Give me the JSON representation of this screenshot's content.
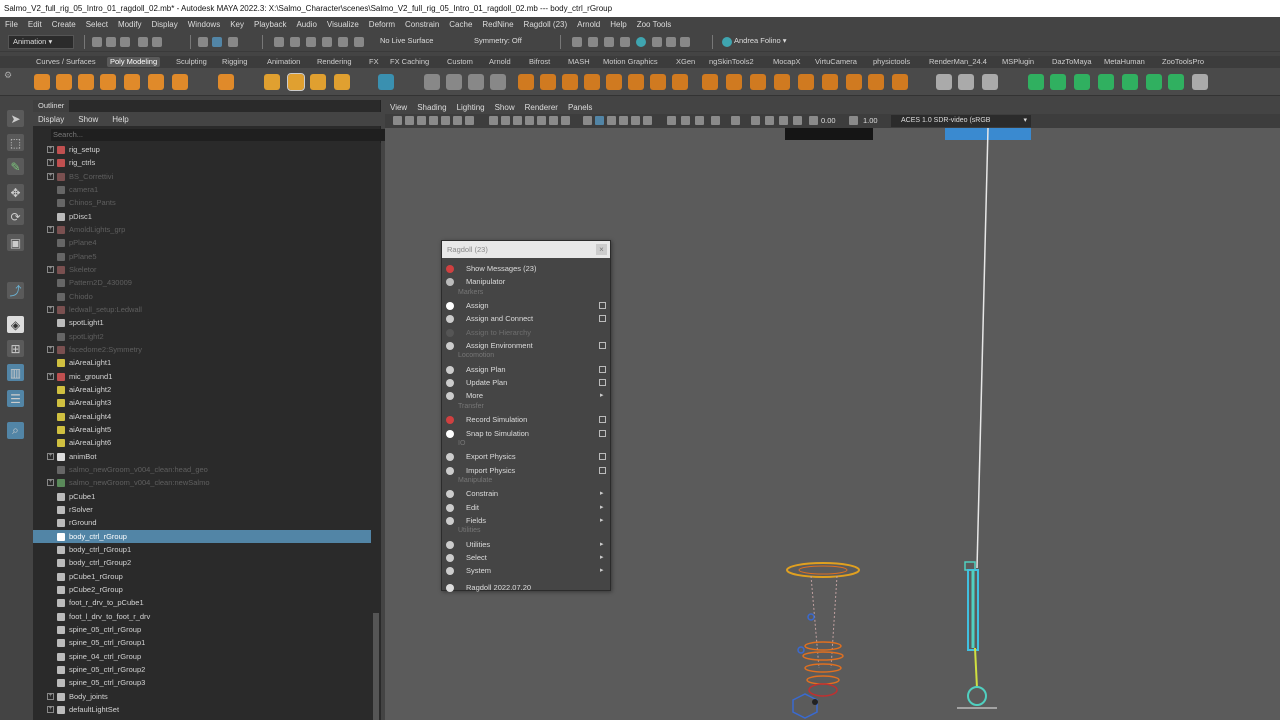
{
  "window": {
    "title": "Salmo_V2_full_rig_05_Intro_01_ragdoll_02.mb* - Autodesk MAYA 2022.3: X:\\Salmo_Character\\scenes\\Salmo_V2_full_rig_05_Intro_01_ragdoll_02.mb --- body_ctrl_rGroup"
  },
  "menubar": [
    "File",
    "Edit",
    "Create",
    "Select",
    "Modify",
    "Display",
    "Windows",
    "Key",
    "Playback",
    "Audio",
    "Visualize",
    "Deform",
    "Constrain",
    "Cache",
    "RedNine",
    "Ragdoll (23)",
    "Arnold",
    "Help",
    "Zoo Tools"
  ],
  "statusline": {
    "mode": "Animation",
    "live_surface": "No Live Surface",
    "symmetry": "Symmetry: Off",
    "user": "Andrea Folino"
  },
  "shelf_tabs": [
    {
      "label": "Curves / Surfaces",
      "active": false
    },
    {
      "label": "Poly Modeling",
      "active": true
    },
    {
      "label": "Sculpting",
      "active": false
    },
    {
      "label": "Rigging",
      "active": false
    },
    {
      "label": "Animation",
      "active": false
    },
    {
      "label": "Rendering",
      "active": false
    },
    {
      "label": "FX",
      "active": false
    },
    {
      "label": "FX Caching",
      "active": false
    },
    {
      "label": "Custom",
      "active": false
    },
    {
      "label": "Arnold",
      "active": false
    },
    {
      "label": "Bifrost",
      "active": false
    },
    {
      "label": "MASH",
      "active": false
    },
    {
      "label": "Motion Graphics",
      "active": false
    },
    {
      "label": "XGen",
      "active": false
    },
    {
      "label": "ngSkinTools2",
      "active": false
    },
    {
      "label": "MocapX",
      "active": false
    },
    {
      "label": "VirtuCamera",
      "active": false
    },
    {
      "label": "physictools",
      "active": false
    },
    {
      "label": "RenderMan_24.4",
      "active": false
    },
    {
      "label": "MSPlugin",
      "active": false
    },
    {
      "label": "DazToMaya",
      "active": false
    },
    {
      "label": "MetaHuman",
      "active": false
    },
    {
      "label": "ZooToolsPro",
      "active": false
    }
  ],
  "outliner": {
    "tab": "Outliner",
    "menu": [
      "Display",
      "Show",
      "Help"
    ],
    "search_placeholder": "Search...",
    "items": [
      {
        "label": "rig_setup",
        "expand": true,
        "dim": false,
        "sel": false,
        "icon": "#c05050"
      },
      {
        "label": "rig_ctrls",
        "expand": true,
        "dim": false,
        "sel": false,
        "icon": "#c05050"
      },
      {
        "label": "BS_Correttivi",
        "expand": true,
        "dim": true,
        "sel": false,
        "icon": "#7a5050"
      },
      {
        "label": "camera1",
        "expand": false,
        "dim": true,
        "sel": false,
        "icon": "#666666"
      },
      {
        "label": "Chinos_Pants",
        "expand": false,
        "dim": true,
        "sel": false,
        "icon": "#666666"
      },
      {
        "label": "pDisc1",
        "expand": false,
        "dim": false,
        "sel": false,
        "icon": "#bbbbbb"
      },
      {
        "label": "AmoldLights_grp",
        "expand": true,
        "dim": true,
        "sel": false,
        "icon": "#7a5050"
      },
      {
        "label": "pPlane4",
        "expand": false,
        "dim": true,
        "sel": false,
        "icon": "#666666"
      },
      {
        "label": "pPlane5",
        "expand": false,
        "dim": true,
        "sel": false,
        "icon": "#666666"
      },
      {
        "label": "Skeletor",
        "expand": true,
        "dim": true,
        "sel": false,
        "icon": "#7a5050"
      },
      {
        "label": "Pattern2D_430009",
        "expand": false,
        "dim": true,
        "sel": false,
        "icon": "#666666"
      },
      {
        "label": "Chiodo",
        "expand": false,
        "dim": true,
        "sel": false,
        "icon": "#666666"
      },
      {
        "label": "ledwall_setup:Ledwall",
        "expand": true,
        "dim": true,
        "sel": false,
        "icon": "#7a5050"
      },
      {
        "label": "spotLight1",
        "expand": false,
        "dim": false,
        "sel": false,
        "icon": "#bbbbbb"
      },
      {
        "label": "spotLight2",
        "expand": false,
        "dim": true,
        "sel": false,
        "icon": "#666666"
      },
      {
        "label": "facedome2:Symmetry",
        "expand": true,
        "dim": true,
        "sel": false,
        "icon": "#7a5050"
      },
      {
        "label": "aiAreaLight1",
        "expand": false,
        "dim": false,
        "sel": false,
        "icon": "#d0c040"
      },
      {
        "label": "mic_ground1",
        "expand": true,
        "dim": false,
        "sel": false,
        "icon": "#c05050"
      },
      {
        "label": "aiAreaLight2",
        "expand": false,
        "dim": false,
        "sel": false,
        "icon": "#d0c040"
      },
      {
        "label": "aiAreaLight3",
        "expand": false,
        "dim": false,
        "sel": false,
        "icon": "#d0c040"
      },
      {
        "label": "aiAreaLight4",
        "expand": false,
        "dim": false,
        "sel": false,
        "icon": "#d0c040"
      },
      {
        "label": "aiAreaLight5",
        "expand": false,
        "dim": false,
        "sel": false,
        "icon": "#d0c040"
      },
      {
        "label": "aiAreaLight6",
        "expand": false,
        "dim": false,
        "sel": false,
        "icon": "#d0c040"
      },
      {
        "label": "animBot",
        "expand": true,
        "dim": false,
        "sel": false,
        "icon": "#dddddd"
      },
      {
        "label": "salmo_newGroom_v004_clean:head_geo",
        "expand": false,
        "dim": true,
        "sel": false,
        "icon": "#666666"
      },
      {
        "label": "salmo_newGroom_v004_clean:newSalmo",
        "expand": true,
        "dim": true,
        "sel": false,
        "icon": "#5a8a5a"
      },
      {
        "label": "pCube1",
        "expand": false,
        "dim": false,
        "sel": false,
        "icon": "#bbbbbb"
      },
      {
        "label": "rSolver",
        "expand": false,
        "dim": false,
        "sel": false,
        "icon": "#bbbbbb"
      },
      {
        "label": "rGround",
        "expand": false,
        "dim": false,
        "sel": false,
        "icon": "#bbbbbb"
      },
      {
        "label": "body_ctrl_rGroup",
        "expand": false,
        "dim": false,
        "sel": true,
        "icon": "#ffffff"
      },
      {
        "label": "body_ctrl_rGroup1",
        "expand": false,
        "dim": false,
        "sel": false,
        "icon": "#bbbbbb"
      },
      {
        "label": "body_ctrl_rGroup2",
        "expand": false,
        "dim": false,
        "sel": false,
        "icon": "#bbbbbb"
      },
      {
        "label": "pCube1_rGroup",
        "expand": false,
        "dim": false,
        "sel": false,
        "icon": "#bbbbbb"
      },
      {
        "label": "pCube2_rGroup",
        "expand": false,
        "dim": false,
        "sel": false,
        "icon": "#bbbbbb"
      },
      {
        "label": "foot_r_drv_to_pCube1",
        "expand": false,
        "dim": false,
        "sel": false,
        "icon": "#bbbbbb"
      },
      {
        "label": "foot_l_drv_to_foot_r_drv",
        "expand": false,
        "dim": false,
        "sel": false,
        "icon": "#bbbbbb"
      },
      {
        "label": "spine_05_ctrl_rGroup",
        "expand": false,
        "dim": false,
        "sel": false,
        "icon": "#bbbbbb"
      },
      {
        "label": "spine_05_ctrl_rGroup1",
        "expand": false,
        "dim": false,
        "sel": false,
        "icon": "#bbbbbb"
      },
      {
        "label": "spine_04_ctrl_rGroup",
        "expand": false,
        "dim": false,
        "sel": false,
        "icon": "#bbbbbb"
      },
      {
        "label": "spine_05_ctrl_rGroup2",
        "expand": false,
        "dim": false,
        "sel": false,
        "icon": "#bbbbbb"
      },
      {
        "label": "spine_05_ctrl_rGroup3",
        "expand": false,
        "dim": false,
        "sel": false,
        "icon": "#bbbbbb"
      },
      {
        "label": "Body_joints",
        "expand": true,
        "dim": false,
        "sel": false,
        "icon": "#bbbbbb"
      },
      {
        "label": "defaultLightSet",
        "expand": true,
        "dim": false,
        "sel": false,
        "icon": "#bbbbbb"
      }
    ]
  },
  "viewport": {
    "menu": [
      "View",
      "Shading",
      "Lighting",
      "Show",
      "Renderer",
      "Panels"
    ],
    "exposure": "0.00",
    "gamma": "1.00",
    "color_space": "ACES 1.0 SDR-video (sRGB"
  },
  "ragdoll_menu": {
    "title": "Ragdoll (23)",
    "close_label": "×",
    "items": [
      {
        "type": "item",
        "label": "Show Messages (23)",
        "icon": "#d04040",
        "box": false,
        "arrow": false,
        "disabled": false
      },
      {
        "type": "item",
        "label": "Manipulator",
        "icon": "#bbbbbb",
        "box": false,
        "arrow": false,
        "disabled": false
      },
      {
        "type": "header",
        "label": "Markers"
      },
      {
        "type": "item",
        "label": "Assign",
        "icon": "#ffffff",
        "box": true,
        "arrow": false,
        "disabled": false
      },
      {
        "type": "item",
        "label": "Assign and Connect",
        "icon": "#cccccc",
        "box": true,
        "arrow": false,
        "disabled": false
      },
      {
        "type": "item",
        "label": "Assign to Hierarchy",
        "icon": "#555555",
        "box": false,
        "arrow": false,
        "disabled": true
      },
      {
        "type": "item",
        "label": "Assign Environment",
        "icon": "#cccccc",
        "box": true,
        "arrow": false,
        "disabled": false
      },
      {
        "type": "header",
        "label": "Locomotion"
      },
      {
        "type": "item",
        "label": "Assign Plan",
        "icon": "#cccccc",
        "box": true,
        "arrow": false,
        "disabled": false
      },
      {
        "type": "item",
        "label": "Update Plan",
        "icon": "#cccccc",
        "box": true,
        "arrow": false,
        "disabled": false
      },
      {
        "type": "item",
        "label": "More",
        "icon": "#cccccc",
        "box": false,
        "arrow": true,
        "disabled": false
      },
      {
        "type": "header",
        "label": "Transfer"
      },
      {
        "type": "item",
        "label": "Record Simulation",
        "icon": "#d04040",
        "box": true,
        "arrow": false,
        "disabled": false
      },
      {
        "type": "item",
        "label": "Snap to Simulation",
        "icon": "#ffffff",
        "box": true,
        "arrow": false,
        "disabled": false
      },
      {
        "type": "header",
        "label": "IO"
      },
      {
        "type": "item",
        "label": "Export Physics",
        "icon": "#cccccc",
        "box": true,
        "arrow": false,
        "disabled": false
      },
      {
        "type": "item",
        "label": "Import Physics",
        "icon": "#cccccc",
        "box": true,
        "arrow": false,
        "disabled": false
      },
      {
        "type": "header",
        "label": "Manipulate"
      },
      {
        "type": "item",
        "label": "Constrain",
        "icon": "#cccccc",
        "box": false,
        "arrow": true,
        "disabled": false
      },
      {
        "type": "item",
        "label": "Edit",
        "icon": "#cccccc",
        "box": false,
        "arrow": true,
        "disabled": false
      },
      {
        "type": "item",
        "label": "Fields",
        "icon": "#cccccc",
        "box": false,
        "arrow": true,
        "disabled": false
      },
      {
        "type": "header",
        "label": "Utilities"
      },
      {
        "type": "item",
        "label": "Utilities",
        "icon": "#cccccc",
        "box": false,
        "arrow": true,
        "disabled": false
      },
      {
        "type": "item",
        "label": "Select",
        "icon": "#cccccc",
        "box": false,
        "arrow": true,
        "disabled": false
      },
      {
        "type": "item",
        "label": "System",
        "icon": "#cccccc",
        "box": false,
        "arrow": true,
        "disabled": false
      },
      {
        "type": "item",
        "label": "Ragdoll 2022.07.20",
        "icon": "#dddddd",
        "box": false,
        "arrow": false,
        "disabled": false
      }
    ]
  }
}
